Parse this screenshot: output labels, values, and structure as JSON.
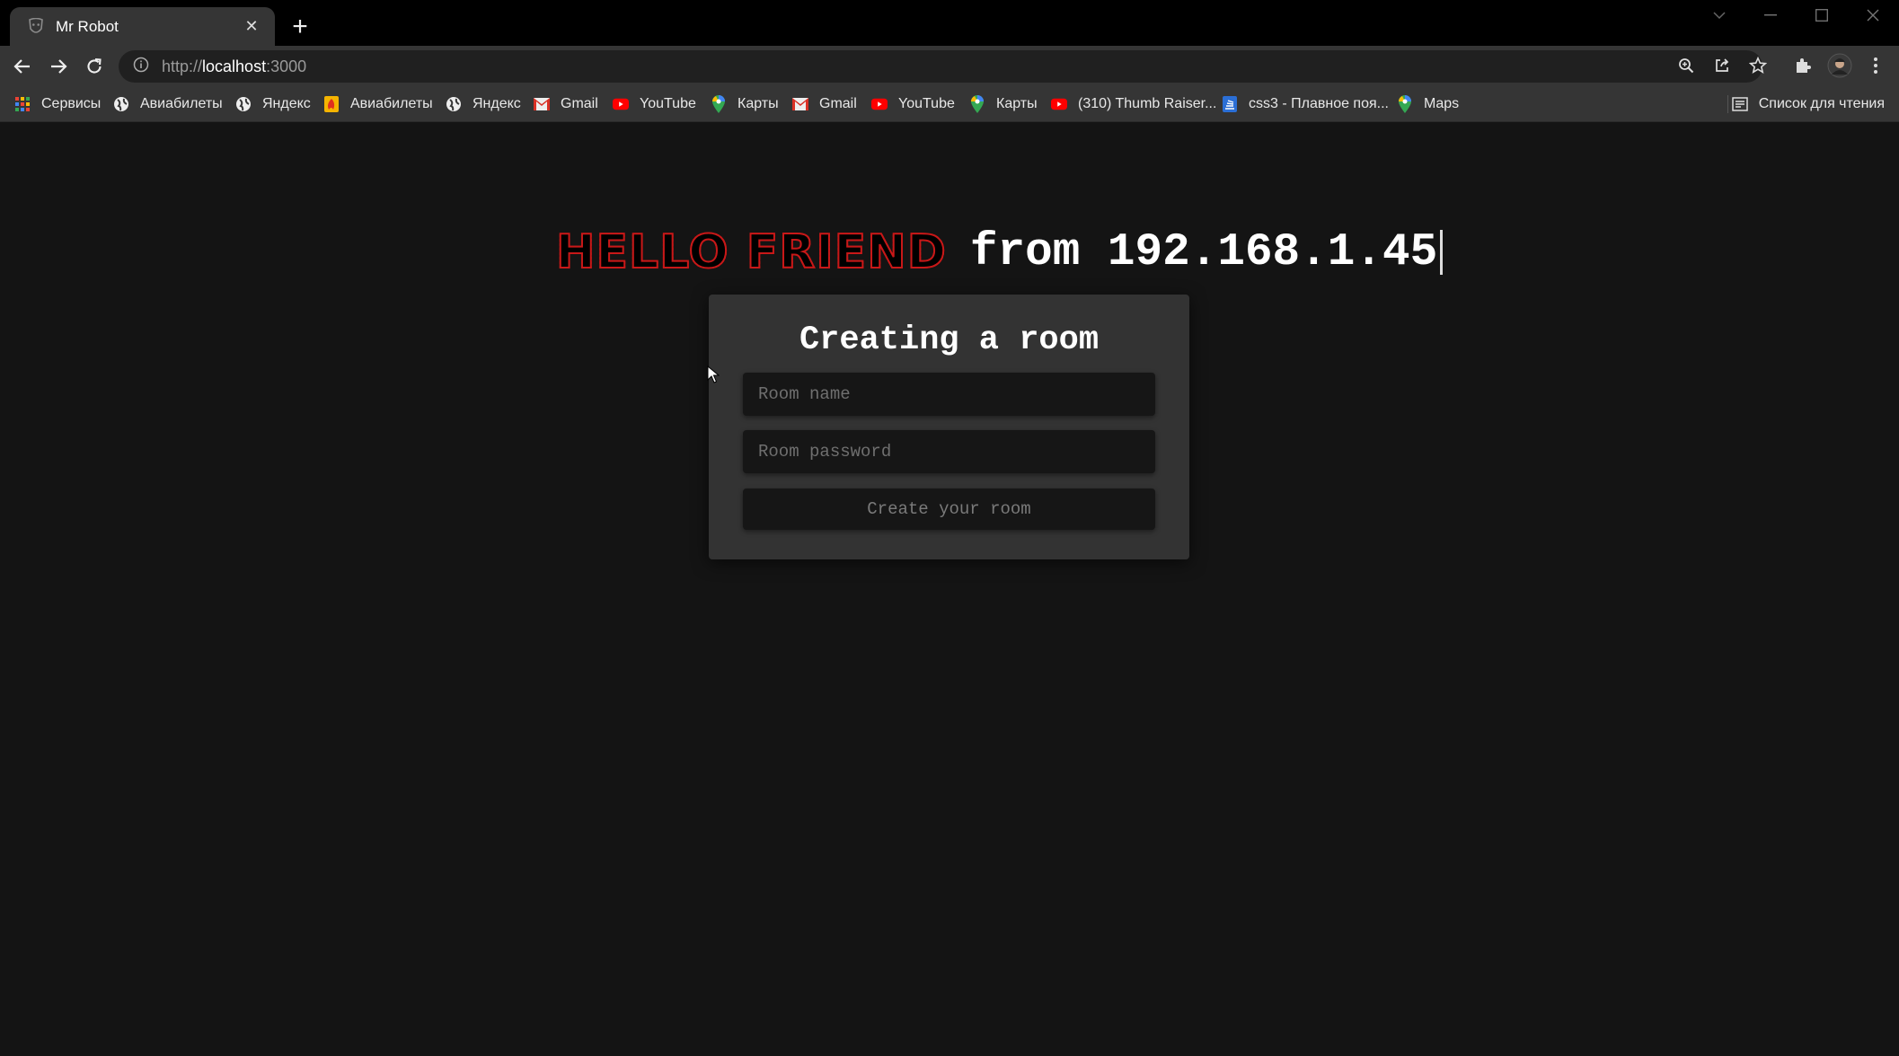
{
  "browser": {
    "tab_title": "Mr Robot",
    "url_scheme": "http://",
    "url_host": "localhost",
    "url_port": ":3000",
    "bookmarks": [
      {
        "label": "Сервисы",
        "icon": "apps-grid-icon"
      },
      {
        "label": "Авиабилеты",
        "icon": "globe-icon"
      },
      {
        "label": "Яндекс",
        "icon": "globe-icon"
      },
      {
        "label": "Авиабилеты",
        "icon": "flame-icon"
      },
      {
        "label": "Яндекс",
        "icon": "globe-icon"
      },
      {
        "label": "Gmail",
        "icon": "gmail-icon"
      },
      {
        "label": "YouTube",
        "icon": "youtube-icon"
      },
      {
        "label": "Карты",
        "icon": "maps-pin-icon"
      },
      {
        "label": "Gmail",
        "icon": "gmail-icon"
      },
      {
        "label": "YouTube",
        "icon": "youtube-icon"
      },
      {
        "label": "Карты",
        "icon": "maps-pin-icon"
      },
      {
        "label": "(310) Thumb Raiser...",
        "icon": "youtube-icon"
      },
      {
        "label": "css3 - Плавное поя...",
        "icon": "stackoverflow-icon"
      },
      {
        "label": "Maps",
        "icon": "maps-pin-icon"
      }
    ],
    "reading_list": "Список для чтения"
  },
  "page": {
    "hello": "HELLO FRIEND",
    "from_ip": "from 192.168.1.45",
    "card_title": "Creating a room",
    "room_name_placeholder": "Room name",
    "room_password_placeholder": "Room password",
    "create_button": "Create your room"
  },
  "colors": {
    "hello_red": "#b01414",
    "page_bg": "#141414",
    "card_bg": "#333333",
    "input_bg": "#161616"
  }
}
